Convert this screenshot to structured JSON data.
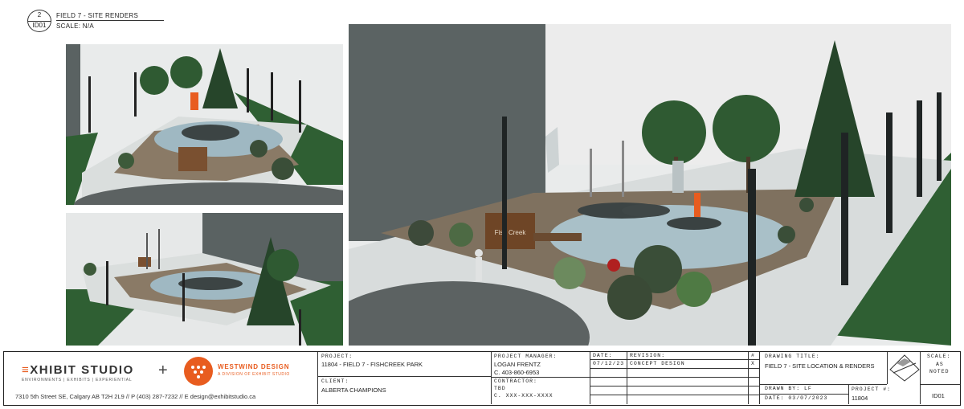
{
  "sheet": {
    "tag_number": "2",
    "tag_code": "ID01",
    "title": "FIELD 7 - SITE RENDERS",
    "scale": "SCALE: N/A"
  },
  "renders": {
    "top_icon": "site-render-aerial",
    "bottom_icon": "site-render-side",
    "main_icon": "site-render-perspective",
    "sign_text": "Fish Creek"
  },
  "colors": {
    "accent": "#e85c1f",
    "grass": "#2f5f33",
    "path": "#d8dcdc",
    "plaza": "#a9c0c8"
  },
  "title_block": {
    "company": {
      "exhibit_e": "≡",
      "exhibit_name": "XHIBIT STUDIO",
      "exhibit_tagline": "ENVIRONMENTS | EXHIBITS | EXPERIENTIAL",
      "plus": "+",
      "partner_name": "WESTWIND DESIGN",
      "partner_tagline": "A DIVISION OF EXHIBIT STUDIO",
      "contact": "7310 5th Street SE, Calgary AB T2H 2L9  //  P (403) 287-7232  //  E design@exhibitstudio.ca"
    },
    "project_label": "PROJECT:",
    "project_value": "11804 - FIELD 7 - FISHCREEK PARK",
    "client_label": "CLIENT:",
    "client_value": "ALBERTA CHAMPIONS",
    "pm_label": "PROJECT MANAGER:",
    "pm_name": "LOGAN FRENTZ",
    "pm_phone": "C. 403-860-6953",
    "contractor_label": "CONTRACTOR:",
    "contractor_name": "TBD",
    "contractor_phone": "C. XXX-XXX-XXXX",
    "date_label": "DATE:",
    "date_value": "07/12/23",
    "revision_label": "REVISION:",
    "revision_value": "CONCEPT DESIGN",
    "rev_num_label": "#",
    "rev_num_value": "X",
    "drawing_title_label": "DRAWING TITLE:",
    "drawing_title_value": "FIELD 7 - SITE LOCATION & RENDERS",
    "drawn_by": "DRAWN BY: LF",
    "date_drawn": "DATE: 03/07/2023",
    "project_num_label": "PROJECT #:",
    "project_num_value": "11804",
    "scale_label": "SCALE:",
    "scale_line1": "AS",
    "scale_line2": "NOTED",
    "sheet_id": "ID01"
  }
}
